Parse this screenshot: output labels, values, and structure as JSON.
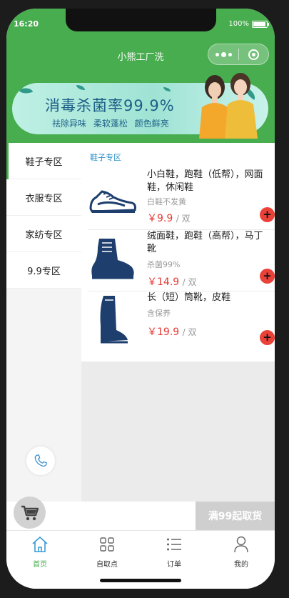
{
  "status_bar": {
    "time": "16:20",
    "battery": "100%"
  },
  "app": {
    "title": "小熊工厂洗"
  },
  "banner": {
    "headline": "消毒杀菌率99.9%",
    "subline": "祛除异味  柔软蓬松  颜色鲜亮"
  },
  "sidebar": {
    "items": [
      {
        "label": "鞋子专区",
        "active": true
      },
      {
        "label": "衣服专区",
        "active": false
      },
      {
        "label": "家纺专区",
        "active": false
      },
      {
        "label": "9.9专区",
        "active": false
      }
    ]
  },
  "section": {
    "title": "鞋子专区"
  },
  "products": [
    {
      "name": "小白鞋，跑鞋（低帮），网面鞋，休闲鞋",
      "desc": "白鞋不发黄",
      "price": "￥9.9",
      "unit": "/ 双",
      "icon": "sneaker-icon"
    },
    {
      "name": "绒面鞋，跑鞋（高帮），马丁靴",
      "desc": "杀菌99%",
      "price": "￥14.9",
      "unit": "/ 双",
      "icon": "boot-icon"
    },
    {
      "name": "长（短）筒靴，皮鞋",
      "desc": "含保养",
      "price": "￥19.9",
      "unit": "/ 双",
      "icon": "tall-boot-icon"
    }
  ],
  "add_label": "+",
  "cart": {
    "checkout_label": "满99起取货"
  },
  "tabbar": {
    "items": [
      {
        "label": "首页",
        "icon": "home-icon",
        "active": true
      },
      {
        "label": "自取点",
        "icon": "grid-icon",
        "active": false
      },
      {
        "label": "订单",
        "icon": "list-icon",
        "active": false
      },
      {
        "label": "我的",
        "icon": "user-icon",
        "active": false
      }
    ]
  },
  "colors": {
    "brand": "#48ad4f",
    "price": "#e53935",
    "add_button": "#ea4139",
    "link": "#2a8fc7"
  }
}
